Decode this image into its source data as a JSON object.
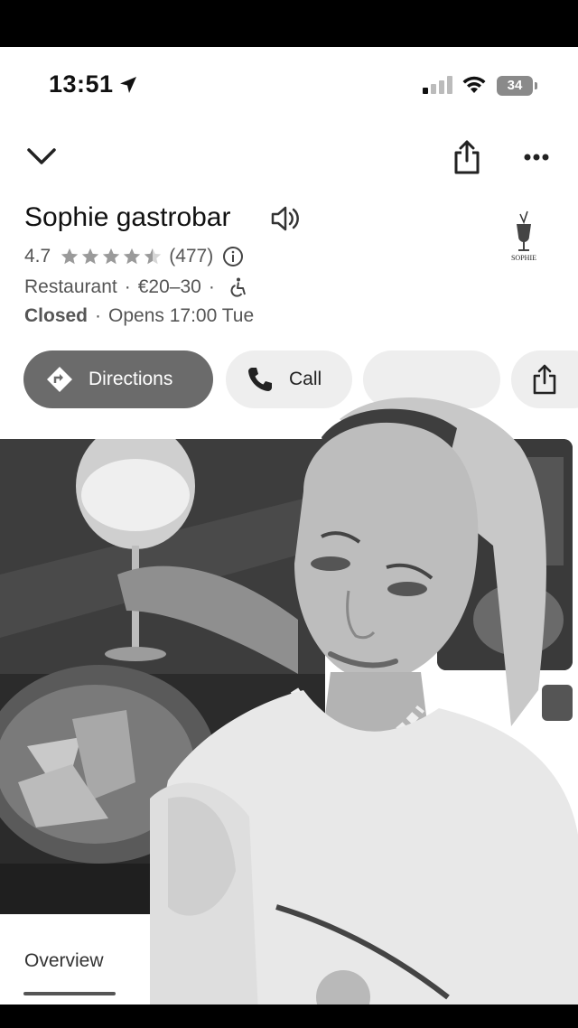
{
  "status_bar": {
    "time": "13:51",
    "battery": "34"
  },
  "place": {
    "name": "Sophie gastrobar",
    "rating": "4.7",
    "stars": 4.7,
    "review_count": "(477)",
    "category": "Restaurant",
    "price": "€20–30",
    "dot": "·",
    "status": "Closed",
    "opens": "Opens 17:00 Tue",
    "logo_text": "SOPHIE"
  },
  "actions": {
    "directions_label": "Directions",
    "call_label": "Call"
  },
  "tabs": {
    "overview_label": "Overview"
  },
  "colors": {
    "chip_dark": "#6b6b6b",
    "chip_light": "#eeeeee"
  },
  "icons": [
    "location-arrow-icon",
    "signal-icon",
    "wifi-icon",
    "battery-icon",
    "chevron-down-icon",
    "share-icon",
    "more-icon",
    "speaker-icon",
    "star-icon",
    "info-icon",
    "accessibility-icon",
    "directions-icon",
    "phone-icon"
  ]
}
